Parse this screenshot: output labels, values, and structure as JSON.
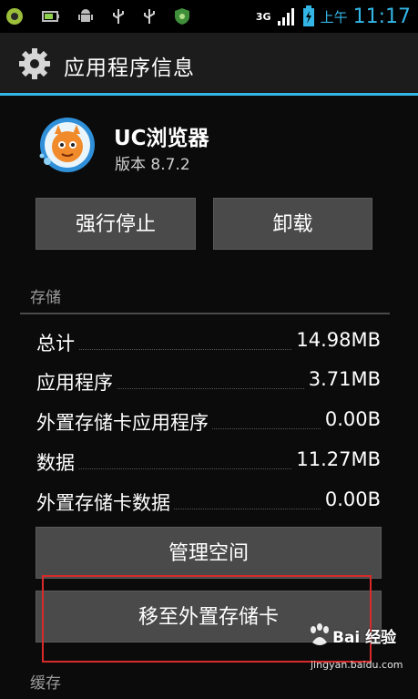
{
  "status_bar": {
    "network": "3G",
    "am_pm": "上午",
    "time": "11:17",
    "icons": [
      "smiley-notification-icon",
      "battery-notification-icon",
      "android-debug-icon",
      "usb-icon",
      "usb-icon",
      "shield-icon",
      "signal-strength-icon",
      "battery-charging-icon"
    ],
    "accent_color": "#33b5e5"
  },
  "action_bar": {
    "icon": "gear-icon",
    "title": "应用程序信息"
  },
  "app": {
    "icon": "uc-browser-squirrel-icon",
    "name": "UC浏览器",
    "version": "版本 8.7.2"
  },
  "buttons": {
    "force_stop": "强行停止",
    "uninstall": "卸载",
    "manage_space": "管理空间",
    "move_to_sd": "移至外置存储卡"
  },
  "storage": {
    "section_title": "存储",
    "rows": [
      {
        "label": "总计",
        "value": "14.98MB"
      },
      {
        "label": "应用程序",
        "value": "3.71MB"
      },
      {
        "label": "外置存储卡应用程序",
        "value": "0.00B"
      },
      {
        "label": "数据",
        "value": "11.27MB"
      },
      {
        "label": "外置存储卡数据",
        "value": "0.00B"
      }
    ]
  },
  "cache": {
    "section_title": "缓存"
  },
  "annotation": {
    "highlight_color": "#d82a2a"
  },
  "watermark": {
    "brand": "Bai 经验",
    "url": "jingyan.baidu.com"
  }
}
